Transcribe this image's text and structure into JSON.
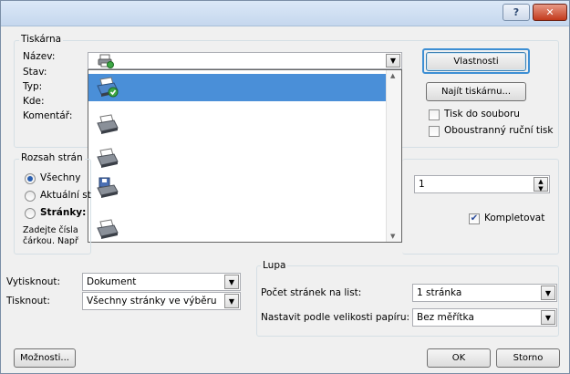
{
  "printer_group": {
    "title": "Tiskárna",
    "name_label": "Název:",
    "status_label": "Stav:",
    "type_label": "Typ:",
    "where_label": "Kde:",
    "comment_label": "Komentář:",
    "properties_button": "Vlastnosti",
    "find_printer_button": "Najít tiskárnu...",
    "print_to_file_label": "Tisk do souboru",
    "manual_duplex_label": "Oboustranný ruční tisk",
    "print_to_file_checked": false,
    "manual_duplex_checked": false
  },
  "page_range_group": {
    "title": "Rozsah strán",
    "all_label": "Všechny",
    "current_label": "Aktuální st",
    "pages_label": "Stránky:",
    "hint_line1": "Zadejte čísla",
    "hint_line2": "čárkou. Např",
    "selected": "all"
  },
  "copies": {
    "count_value": "1",
    "collate_label": "Kompletovat",
    "collate_checked": true
  },
  "zoom_group": {
    "title": "Lupa",
    "pages_per_sheet_label": "Počet stránek na list:",
    "pages_per_sheet_value": "1 stránka",
    "scale_to_paper_label": "Nastavit podle velikosti papíru:",
    "scale_to_paper_value": "Bez měřítka"
  },
  "print_what": {
    "label": "Vytisknout:",
    "value": "Dokument"
  },
  "print": {
    "label": "Tisknout:",
    "value": "Všechny stránky ve výběru"
  },
  "footer": {
    "options_button": "Možnosti...",
    "ok_button": "OK",
    "cancel_button": "Storno"
  },
  "titlebar": {
    "help_glyph": "?",
    "close_glyph": "✕"
  },
  "printer_list": {
    "items": [
      {
        "name": "",
        "selected": true,
        "icon": "printer-default-icon"
      },
      {
        "name": "",
        "selected": false,
        "icon": "printer-icon"
      },
      {
        "name": "",
        "selected": false,
        "icon": "printer-icon"
      },
      {
        "name": "",
        "selected": false,
        "icon": "printer-fax-icon"
      },
      {
        "name": "",
        "selected": false,
        "icon": "printer-icon"
      }
    ]
  },
  "colors": {
    "selection": "#4a8fd8",
    "focus": "#3d8fd4",
    "titlebar": "#c5d7ee",
    "close": "#c2391b"
  }
}
